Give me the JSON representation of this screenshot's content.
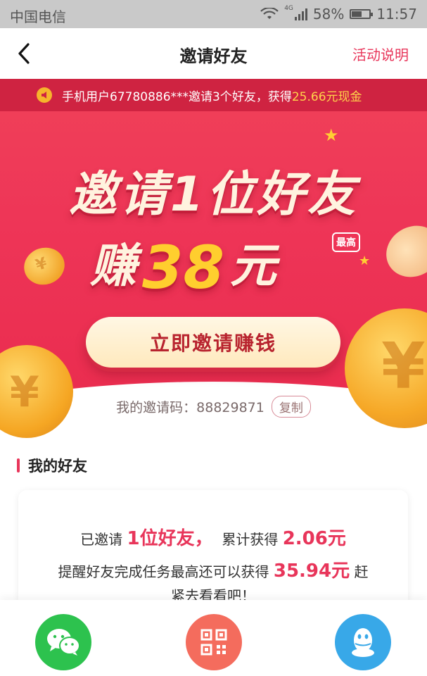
{
  "status_bar": {
    "carrier": "中国电信",
    "network": "4G",
    "battery": "58%",
    "battery_level": 0.58,
    "time": "11:57"
  },
  "nav": {
    "title": "邀请好友",
    "action_label": "活动说明"
  },
  "marquee": {
    "text": "手机用户67780886***邀请3个好友，获得",
    "highlight": "25.66元现金"
  },
  "hero": {
    "headline": "邀请1位好友",
    "earn_prefix": "赚",
    "amount": "38",
    "unit": "元",
    "max_badge": "最高",
    "cta_label": "立即邀请赚钱",
    "invite_code_label": "我的邀请码：",
    "invite_code": "88829871",
    "copy_label": "复制"
  },
  "friends": {
    "section_title": "我的好友",
    "invited_prefix": "已邀请",
    "invited_value": "1位好友，",
    "earned_prefix": "累计获得",
    "earned_value": "2.06元",
    "remind_prefix": "提醒好友完成任务最高还可以获得",
    "remind_value": "35.94元",
    "remind_suffix": "赶",
    "remind_tail": "紧去看看吧！"
  },
  "share": {
    "wechat_icon": "wechat-icon",
    "qr_icon": "qr-code-icon",
    "qq_icon": "qq-icon"
  },
  "colors": {
    "accent": "#e8355a",
    "hero_red": "#ee3557",
    "gold": "#ffce2e",
    "wechat_green": "#2dc24e",
    "qr_orange": "#f46c5d",
    "qq_blue": "#38a8e8"
  }
}
